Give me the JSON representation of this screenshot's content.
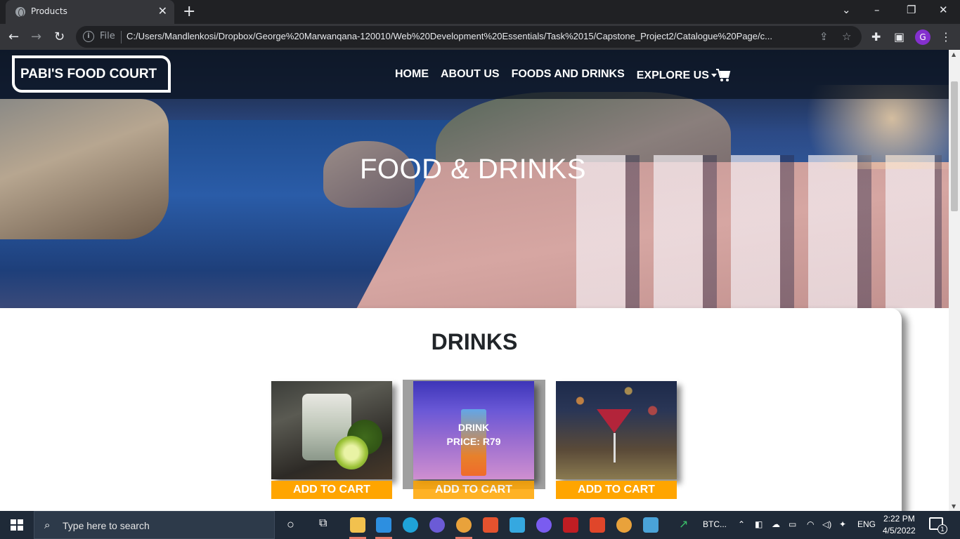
{
  "browser": {
    "tab_title": "Products",
    "tab_close": "✕",
    "new_tab": "+",
    "address_prefix": "File",
    "url": "C:/Users/Mandlenkosi/Dropbox/George%20Marwanqana-120010/Web%20Development%20Essentials/Task%2015/Capstone_Project2/Catalogue%20Page/c...",
    "profile_initial": "G"
  },
  "site": {
    "brand": "PABI'S FOOD COURT",
    "nav": [
      "HOME",
      "ABOUT US",
      "FOODS AND DRINKS",
      "EXPLORE US"
    ],
    "hero_title": "FOOD & DRINKS",
    "section_title": "DRINKS",
    "hover_card": {
      "name": "DRINK",
      "price": "PRICE: R79"
    },
    "products": [
      {
        "button": "ADD TO CART"
      },
      {
        "button": "ADD TO CART"
      },
      {
        "button": "ADD TO CART"
      }
    ]
  },
  "taskbar": {
    "search_placeholder": "Type here to search",
    "ticker": "BTC...",
    "language": "ENG",
    "time": "2:22 PM",
    "date": "4/5/2022",
    "notification_count": "1"
  },
  "colors": {
    "accent_button": "#ffa500",
    "navbar": "#0a121e"
  }
}
